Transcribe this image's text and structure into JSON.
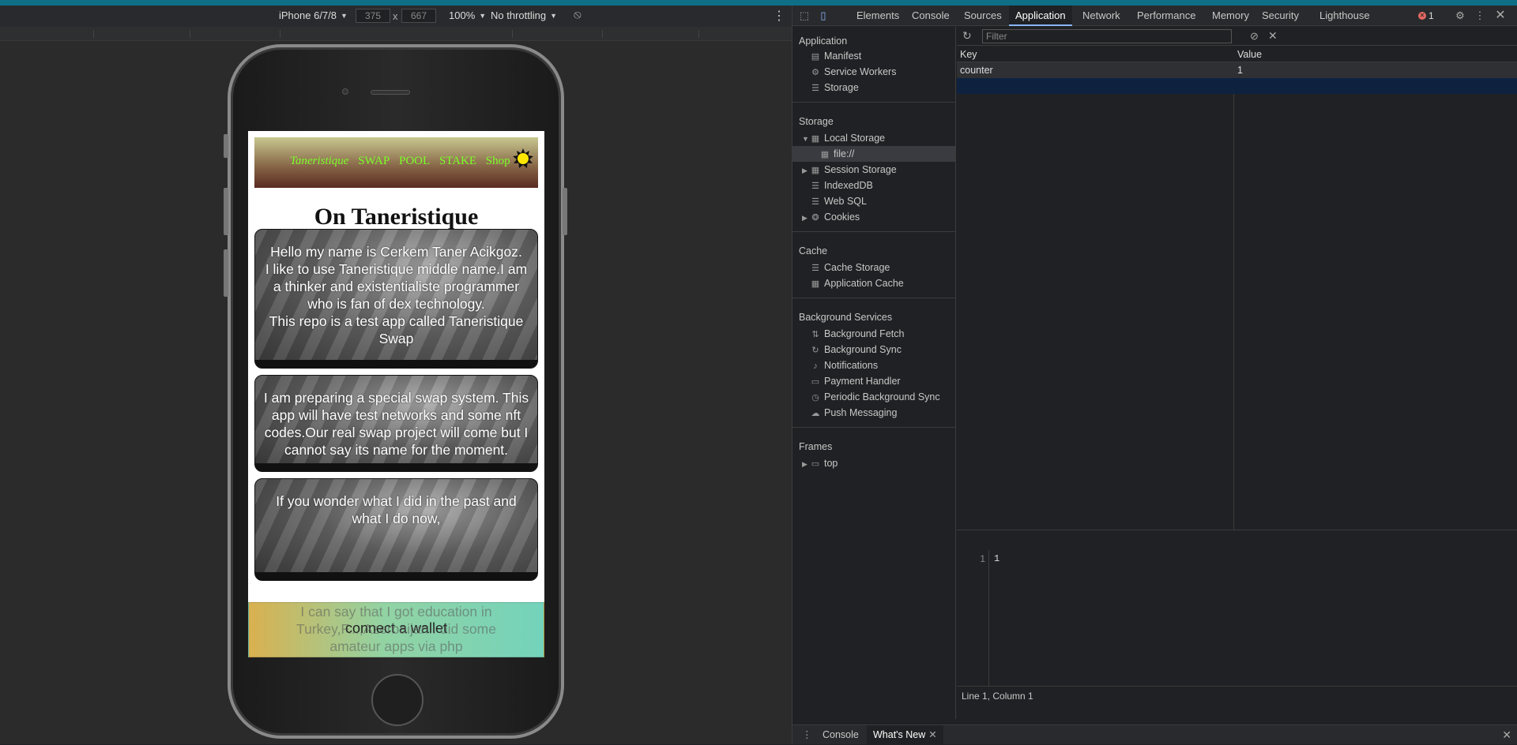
{
  "device_toolbar": {
    "device": "iPhone 6/7/8",
    "width": "375",
    "height": "667",
    "x_sep": "x",
    "zoom": "100%",
    "throttling": "No throttling"
  },
  "site": {
    "nav": {
      "brand": "Taneristique",
      "swap": "SWAP",
      "pool": "POOL",
      "stake": "STAKE",
      "shop": "Shop"
    },
    "title": "On Taneristique",
    "cards": [
      "Hello my name is Cerkem Taner Acikgoz.\nI like to use Taneristique middle name.I am a thinker and existentialiste programmer who is fan of dex technology.\nThis repo is a test app called Taneristique Swap",
      "I am preparing a special swap system. This app will have test networks and some nft codes.Our real swap project will come but I cannot say its name for the moment.",
      "If you wonder what I did in the past and what I do now,",
      "I can say that I got education in Turkey,F...,Azerbaijan.I did some amateur apps via php"
    ],
    "connect_label": "connect a wallet"
  },
  "devtools": {
    "tabs": [
      "Elements",
      "Console",
      "Sources",
      "Application",
      "Network",
      "Performance",
      "Memory",
      "Security",
      "Lighthouse"
    ],
    "active_tab": "Application",
    "error_count": "1",
    "sidebar": {
      "application_title": "Application",
      "application_items": [
        "Manifest",
        "Service Workers",
        "Storage"
      ],
      "storage_title": "Storage",
      "local_storage": "Local Storage",
      "local_storage_child": "file://",
      "storage_items": [
        "Session Storage",
        "IndexedDB",
        "Web SQL",
        "Cookies"
      ],
      "cache_title": "Cache",
      "cache_items": [
        "Cache Storage",
        "Application Cache"
      ],
      "bg_title": "Background Services",
      "bg_items": [
        "Background Fetch",
        "Background Sync",
        "Notifications",
        "Payment Handler",
        "Periodic Background Sync",
        "Push Messaging"
      ],
      "frames_title": "Frames",
      "frames_item": "top"
    },
    "filter_placeholder": "Filter",
    "grid": {
      "headers": [
        "Key",
        "Value"
      ],
      "rows": [
        {
          "key": "counter",
          "value": "1"
        }
      ]
    },
    "editor": {
      "line_number": "1",
      "content": "1"
    },
    "status": "Line 1, Column 1",
    "drawer_tabs": [
      "Console",
      "What's New"
    ]
  },
  "colors": {
    "accent": "#8ab4f8",
    "nav_text": "#7cff2a",
    "topstripe": "#0e6f87"
  }
}
